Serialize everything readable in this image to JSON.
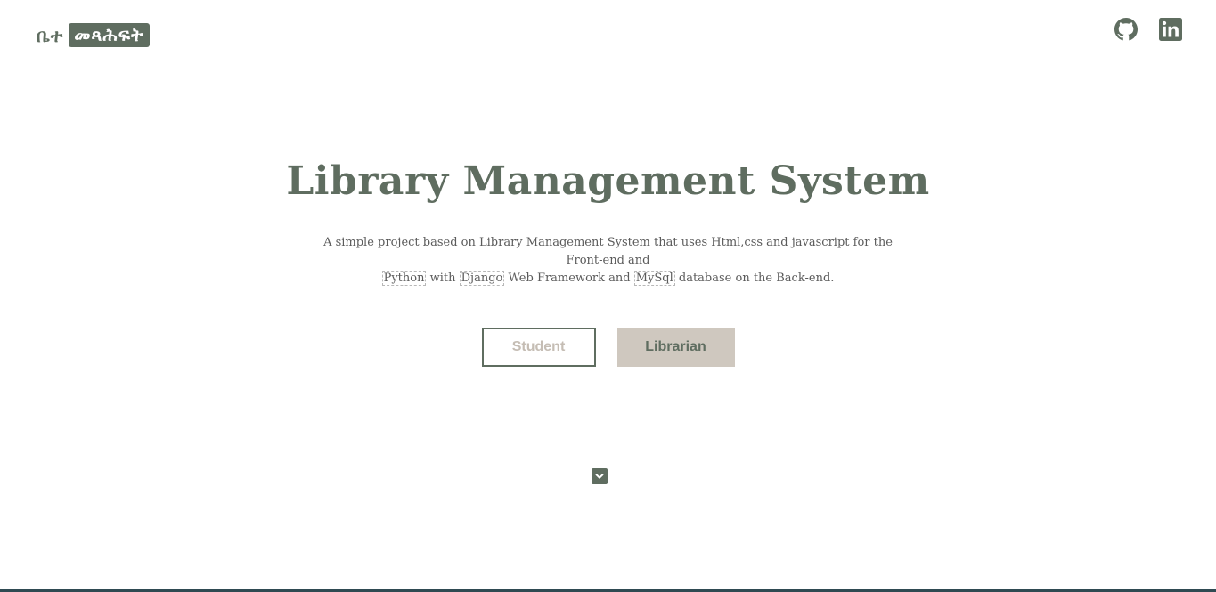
{
  "header": {
    "logo_part1": "ቤተ",
    "logo_part2": "መጻሕፍት",
    "social": [
      {
        "icon": "github-icon"
      },
      {
        "icon": "linkedin-icon"
      }
    ]
  },
  "hero": {
    "title": "Library Management System",
    "desc_part1": "A simple project based on Library Management System that uses Html,css and javascript for the Front-end and",
    "tech1": "Python",
    "desc_part2": " with ",
    "tech2": "Django",
    "desc_part3": " Web Framework and ",
    "tech3": "MySql",
    "desc_part4": " database on the Back-end."
  },
  "buttons": {
    "student_label": "Student",
    "librarian_label": "Librarian"
  },
  "scroll": {
    "icon": "chevron-down-icon"
  },
  "colors": {
    "primary": "#5f6d60",
    "accent": "#cfc8bf",
    "muted_text": "#c5bdb4"
  }
}
